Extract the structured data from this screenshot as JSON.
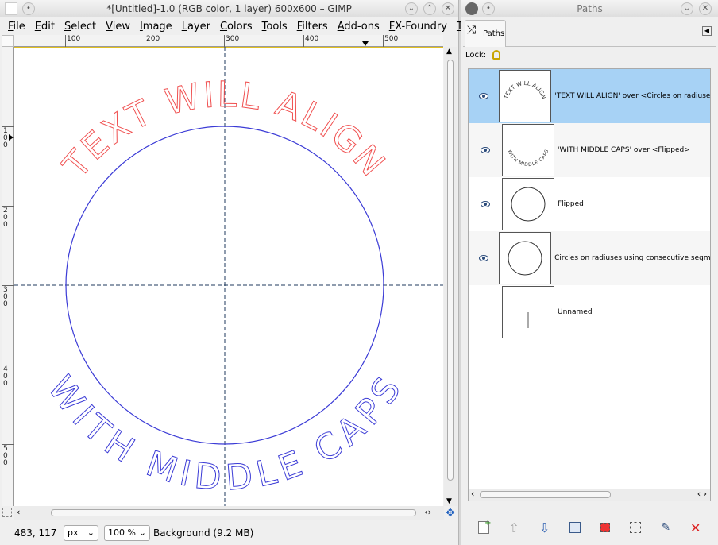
{
  "gimp": {
    "title": "*[Untitled]-1.0 (RGB color, 1 layer) 600x600 – GIMP",
    "menus": [
      "File",
      "Edit",
      "Select",
      "View",
      "Image",
      "Layer",
      "Colors",
      "Tools",
      "Filters",
      "Add-ons",
      "FX-Foundry",
      "Try"
    ],
    "ruler_h": [
      "100",
      "200",
      "300",
      "400",
      "500"
    ],
    "ruler_v": [
      "1\n0\n0",
      "2\n0\n0",
      "3\n0\n0",
      "4\n0\n0",
      "5\n0\n0"
    ],
    "canvas_text": {
      "top": "TEXT WILL ALIGN",
      "bottom": "WITH MIDDLE CAPS"
    },
    "status": {
      "coords": "483, 117",
      "unit": "px",
      "zoom": "100 %",
      "layer_info": "Background (9.2 MB)"
    }
  },
  "paths": {
    "title": "Paths",
    "tab_label": "Paths",
    "lock_label": "Lock:",
    "items": [
      {
        "name": "'TEXT WILL ALIGN' over <Circles on radiuses us",
        "thumb": "TEXT WILL ALIGN"
      },
      {
        "name": "'WITH MIDDLE CAPS' over <Flipped>",
        "thumb": "WITH MIDDLE CAPS"
      },
      {
        "name": "Flipped"
      },
      {
        "name": "Circles on radiuses using consecutive segments"
      },
      {
        "name": "Unnamed"
      }
    ]
  },
  "colors": {
    "selection": "#a7d2f5",
    "red_path": "#f05050",
    "blue_path": "#3b3bd6",
    "guide": "#1f3a5c"
  }
}
